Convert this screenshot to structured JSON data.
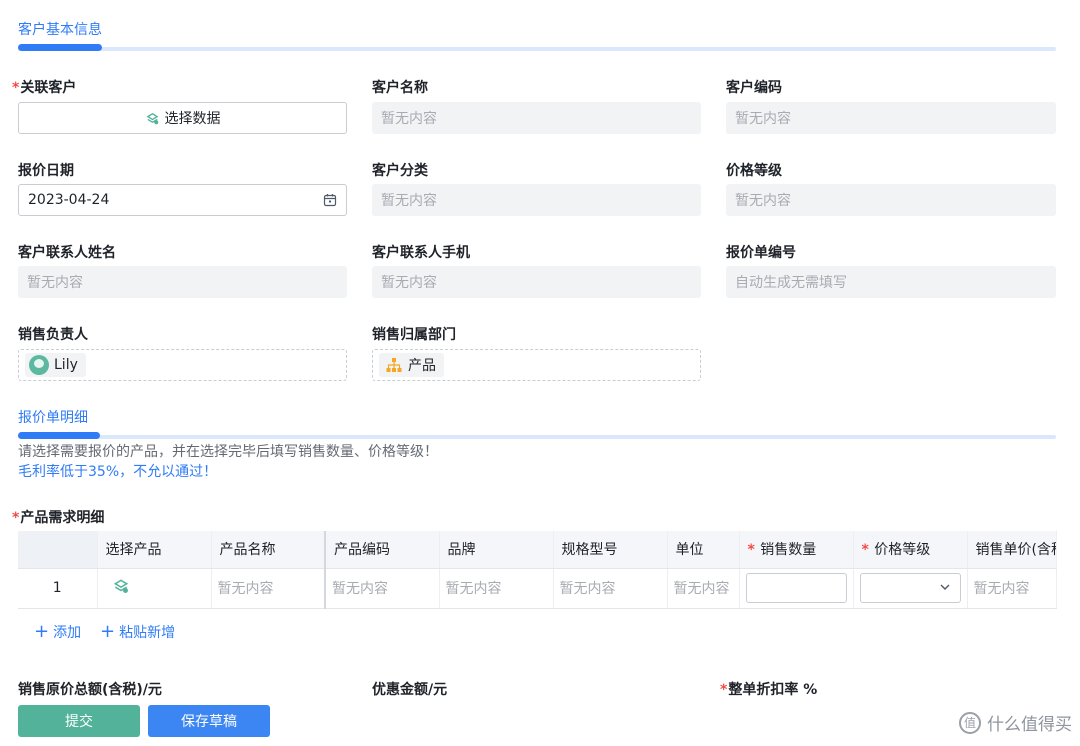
{
  "sections": {
    "basic_info": "客户基本信息",
    "quote_detail": "报价单明细"
  },
  "fields": {
    "related_customer": {
      "label": "关联客户",
      "button": "选择数据"
    },
    "customer_name": {
      "label": "客户名称",
      "value": "暂无内容"
    },
    "customer_code": {
      "label": "客户编码",
      "value": "暂无内容"
    },
    "quote_date": {
      "label": "报价日期",
      "value": "2023-04-24"
    },
    "customer_category": {
      "label": "客户分类",
      "value": "暂无内容"
    },
    "price_level": {
      "label": "价格等级",
      "value": "暂无内容"
    },
    "contact_name": {
      "label": "客户联系人姓名",
      "value": "暂无内容"
    },
    "contact_phone": {
      "label": "客户联系人手机",
      "value": "暂无内容"
    },
    "quote_number": {
      "label": "报价单编号",
      "value": "自动生成无需填写"
    },
    "sales_owner": {
      "label": "销售负责人",
      "value": "Lily"
    },
    "sales_dept": {
      "label": "销售归属部门",
      "value": "产品"
    }
  },
  "notes": {
    "line1": "请选择需要报价的产品，并在选择完毕后填写销售数量、价格等级！",
    "line2": "毛利率低于35%，不允以通过！"
  },
  "product_table": {
    "label": "产品需求明细",
    "columns": [
      "",
      "选择产品",
      "产品名称",
      "产品编码",
      "品牌",
      "规格型号",
      "单位",
      "销售数量",
      "价格等级",
      "销售单价(含税"
    ],
    "required_marker": "*",
    "rows": [
      {
        "index": "1",
        "name": "暂无内容",
        "code": "暂无内容",
        "brand": "暂无内容",
        "spec": "暂无内容",
        "unit": "暂无内容",
        "unit_price": "暂无内容"
      }
    ],
    "add_label": "添加",
    "paste_label": "粘贴新增"
  },
  "bottom_fields": {
    "original_total": "销售原价总额(含税)/元",
    "discount_amount": "优惠金额/元",
    "discount_rate": "整单折扣率 %"
  },
  "actions": {
    "submit": "提交",
    "save_draft": "保存草稿"
  },
  "watermark": {
    "text": "什么值得买",
    "logo": "值"
  },
  "colors": {
    "accent": "#2f7cf6",
    "submit": "#53b39a",
    "draft": "#3b86f2",
    "required": "#f54a45"
  }
}
